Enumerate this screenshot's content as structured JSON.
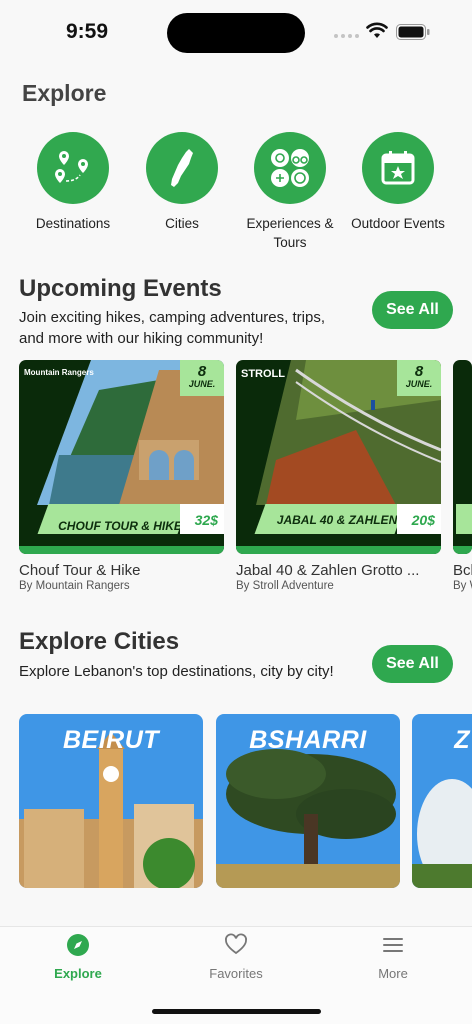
{
  "status": {
    "time": "9:59"
  },
  "page_title": "Explore",
  "categories": [
    {
      "label": "Destinations",
      "icon": "map-pins-icon"
    },
    {
      "label": "Cities",
      "icon": "lebanon-map-icon"
    },
    {
      "label": "Experiences & Tours",
      "icon": "activities-icon"
    },
    {
      "label": "Outdoor Events",
      "icon": "calendar-star-icon"
    }
  ],
  "upcoming": {
    "title": "Upcoming Events",
    "subtitle": "Join exciting hikes, camping adventures, trips, and more with our hiking community!",
    "see_all": "See All",
    "events": [
      {
        "day": "8",
        "month": "JUNE.",
        "logo": "Mountain Rangers",
        "banner": "CHOUF TOUR & HIKE",
        "price": "32$",
        "title": "Chouf Tour &  Hike",
        "by": "By Mountain Rangers"
      },
      {
        "day": "8",
        "month": "JUNE.",
        "logo": "STROLL",
        "banner": "JABAL 40 & ZAHLEN",
        "price": "20$",
        "title": "Jabal 40 & Zahlen Grotto ...",
        "by": "By Stroll Adventure"
      },
      {
        "day": "",
        "month": "",
        "logo": "",
        "banner": "",
        "price": "",
        "title": "Bch",
        "by": "By W"
      }
    ]
  },
  "cities": {
    "title": "Explore Cities",
    "subtitle": "Explore Lebanon's top destinations, city by city!",
    "see_all": "See All",
    "items": [
      {
        "name": "BEIRUT"
      },
      {
        "name": "BSHARRI"
      },
      {
        "name": "Z"
      }
    ]
  },
  "tabs": [
    {
      "label": "Explore",
      "icon": "compass-icon",
      "active": true
    },
    {
      "label": "Favorites",
      "icon": "heart-icon",
      "active": false
    },
    {
      "label": "More",
      "icon": "menu-icon",
      "active": false
    }
  ],
  "colors": {
    "accent": "#2fa84f",
    "light_green": "#a7e59a",
    "dark_green": "#0d2e0d"
  }
}
